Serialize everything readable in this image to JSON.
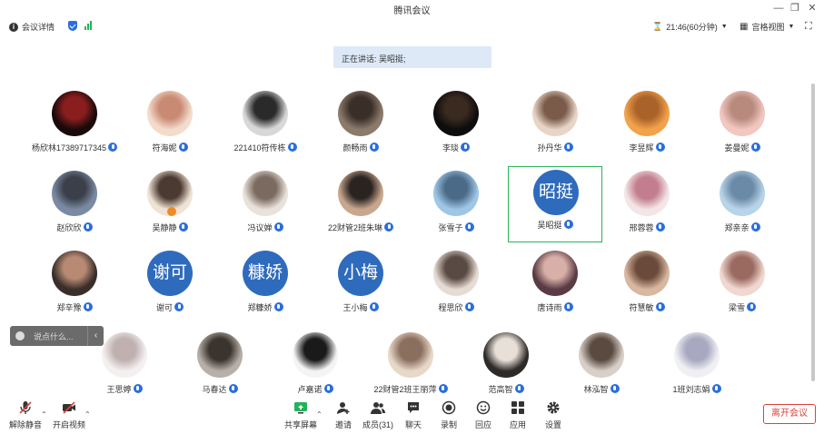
{
  "window": {
    "title": "腾讯会议"
  },
  "infobar": {
    "details_label": "会议详情",
    "timer": "21:46(60分钟)",
    "view_label": "宫格视图"
  },
  "speaking": {
    "text": "正在讲话: 吴昭挺;"
  },
  "participants": [
    {
      "name": "杨欣林17389717345"
    },
    {
      "name": "符海妮"
    },
    {
      "name": "221410符传栋"
    },
    {
      "name": "颜畅雨"
    },
    {
      "name": "李琰"
    },
    {
      "name": "孙丹华"
    },
    {
      "name": "李昱辉"
    },
    {
      "name": "姜曼妮"
    },
    {
      "name": "赵欣欣"
    },
    {
      "name": "吴静静"
    },
    {
      "name": "冯议婵"
    },
    {
      "name": "22财管2班朱琳"
    },
    {
      "name": "张雪子"
    },
    {
      "name": "吴昭挺",
      "avatar_text": "昭挺"
    },
    {
      "name": "邢蓉蓉"
    },
    {
      "name": "郑亲亲"
    },
    {
      "name": "郑辛豫"
    },
    {
      "name": "谢可",
      "avatar_text": "谢可"
    },
    {
      "name": "郑糠娇",
      "avatar_text": "糠娇"
    },
    {
      "name": "王小梅",
      "avatar_text": "小梅"
    },
    {
      "name": "程思欣"
    },
    {
      "name": "唐诗雨"
    },
    {
      "name": "符慧敏"
    },
    {
      "name": "梁雪"
    },
    {
      "name": "王思婷"
    },
    {
      "name": "马春达"
    },
    {
      "name": "卢嘉诺"
    },
    {
      "name": "22财管2班王丽萍"
    },
    {
      "name": "范高智"
    },
    {
      "name": "林泓智"
    },
    {
      "name": "1班刘志娟"
    }
  ],
  "chat": {
    "placeholder": "说点什么..."
  },
  "toolbar": {
    "unmute": "解除静音",
    "video": "开启视频",
    "share": "共享屏幕",
    "invite": "邀请",
    "members": "成员(31)",
    "chat": "聊天",
    "record": "录制",
    "reaction": "回应",
    "apps": "应用",
    "settings": "设置",
    "leave": "离开会议"
  },
  "colors": {
    "accent": "#2a6fdb",
    "active_border": "#2bb35a",
    "leave": "#e0413a",
    "avatar_text_bg": "#2e6bbd"
  }
}
